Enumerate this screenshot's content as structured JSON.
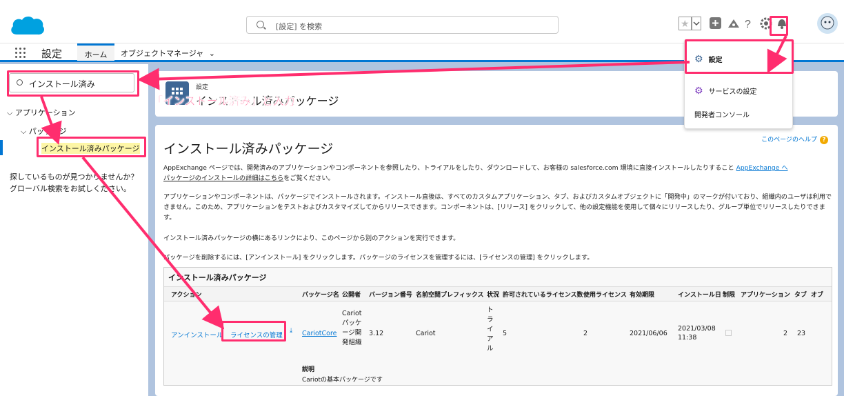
{
  "header": {
    "search_placeholder": "[設定] を検索"
  },
  "nav": {
    "app_name": "設定",
    "tab_home": "ホーム",
    "tab_object_manager": "オブジェクトマネージャ"
  },
  "sidebar": {
    "quick_find": "インストール済み",
    "tree_apps": "アプリケーション",
    "tree_packages": "パッケージ",
    "tree_installed": "インストール済みパッケージ",
    "help_text": "探しているものが見つかりませんか？グローバル検索をお試しください。"
  },
  "page_header": {
    "breadcrumb": "設定",
    "title": "インストール済みパッケージ"
  },
  "dropdown": {
    "settings": "設定",
    "service_settings": "サービスの設定",
    "dev_console": "開発者コンソール"
  },
  "annotation": {
    "callout": "「インストール済み」と入力"
  },
  "main": {
    "title": "インストール済みパッケージ",
    "help_link": "このページのヘルプ",
    "p1a": "AppExchange ページでは、開発済みのアプリケーションやコンポーネントを参照したり、トライアルをしたり、ダウンロードして、お客様の salesforce.com 環境に直接インストールしたりすること",
    "p1_link": "AppExchange へ",
    "p1b_link": "パッケージのインストールの詳細はこちら",
    "p1b": "をご覧ください。",
    "p2": "アプリケーションやコンポーネントは、パッケージでインストールされます。インストール直後は、すべてのカスタムアプリケーション、タブ、およびカスタムオブジェクトに「開発中」のマークが付いており、組織内のユーザは利用できません。このため、アプリケーションをテストおよびカスタマイズしてからリリースできます。コンポーネントは、[リリース] をクリックして、他の設定機能を使用して個々にリリースしたり、グループ単位でリリースしたりできます。",
    "p3": "インストール済みパッケージの横にあるリンクにより、このページから別のアクションを実行できます。",
    "p4": "パッケージを削除するには、[アンインストール] をクリックします。パッケージのライセンスを管理するには、[ライセンスの管理] をクリックします。"
  },
  "table": {
    "caption": "インストール済みパッケージ",
    "headers": [
      "アクション",
      "パッケージ名",
      "公開者",
      "バージョン番号",
      "名前空間プレフィックス",
      "状況",
      "許可されているライセンス数",
      "使用ライセンス",
      "有効期限",
      "インストール日",
      "制限",
      "アプリケーション",
      "タブ",
      "オブ"
    ],
    "row": {
      "uninstall": "アンインストール",
      "manage_license": "ライセンスの管理",
      "package_name": "CariotCore",
      "publisher": "Cariot パッケージ開発組織",
      "version": "3.12",
      "namespace": "Cariot",
      "status": "トライアル",
      "allowed": "5",
      "used": "2",
      "expires": "2021/06/06",
      "installed": "2021/03/08 11:38",
      "apps": "2",
      "tabs": "23"
    },
    "desc_label": "説明",
    "desc": "Cariotの基本パッケージです"
  },
  "colors": {
    "accent": "#0176d3",
    "annotation": "#ff2d6e"
  }
}
